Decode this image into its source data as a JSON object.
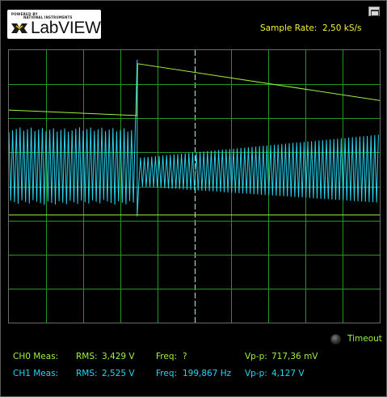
{
  "header": {
    "logo_brand": "LabVIEW",
    "logo_powered_by": "POWERED BY",
    "logo_company": "NATIONAL INSTRUMENTS",
    "sample_rate_label": "Sample Rate:",
    "sample_rate_value": "2,50 kS/s"
  },
  "status": {
    "timeout_label": "Timeout",
    "timeout_led_on": false
  },
  "measurements": {
    "ch0": {
      "label": "CH0 Meas:",
      "rms_label": "RMS:",
      "rms": "3,429 V",
      "freq_label": "Freq:",
      "freq": "?",
      "vpp_label": "Vp-p:",
      "vpp": "717,36 mV"
    },
    "ch1": {
      "label": "CH1 Meas:",
      "rms_label": "RMS:",
      "rms": "2,525 V",
      "freq_label": "Freq:",
      "freq": "199,867 Hz",
      "vpp_label": "Vp-p:",
      "vpp": "4,127 V"
    }
  },
  "colors": {
    "ch0": "#9ff240",
    "ch1": "#2ad4f0",
    "grid": "#1f9a1f",
    "background": "#000000",
    "rate_text": "#f2f23a"
  },
  "icons": {
    "restore": "window-restore-icon",
    "led": "timeout-led-icon"
  },
  "chart_data": {
    "type": "line",
    "grid": {
      "divisions_x": 10,
      "divisions_y": 8
    },
    "series": [
      {
        "channel": "CH0",
        "color": "#9ff240",
        "points": [
          [
            0,
            0.56
          ],
          [
            3.45,
            0.52
          ],
          [
            3.47,
            0.9
          ],
          [
            10,
            0.63
          ]
        ],
        "baseline_points": [
          [
            0,
            -0.21
          ],
          [
            10,
            -0.21
          ]
        ]
      },
      {
        "channel": "CH1",
        "color": "#2ad4f0",
        "envelope": {
          "before_step": {
            "from": 0,
            "to": 3.45,
            "high": 0.4,
            "low": -0.1
          },
          "spike": {
            "at": 3.46,
            "high": 0.93,
            "low": -0.22
          },
          "after_step": {
            "from": 3.5,
            "to": 10,
            "high_start": 0.21,
            "low_start": 0.0,
            "high_end": 0.38,
            "low_end": -0.12
          }
        }
      }
    ]
  }
}
